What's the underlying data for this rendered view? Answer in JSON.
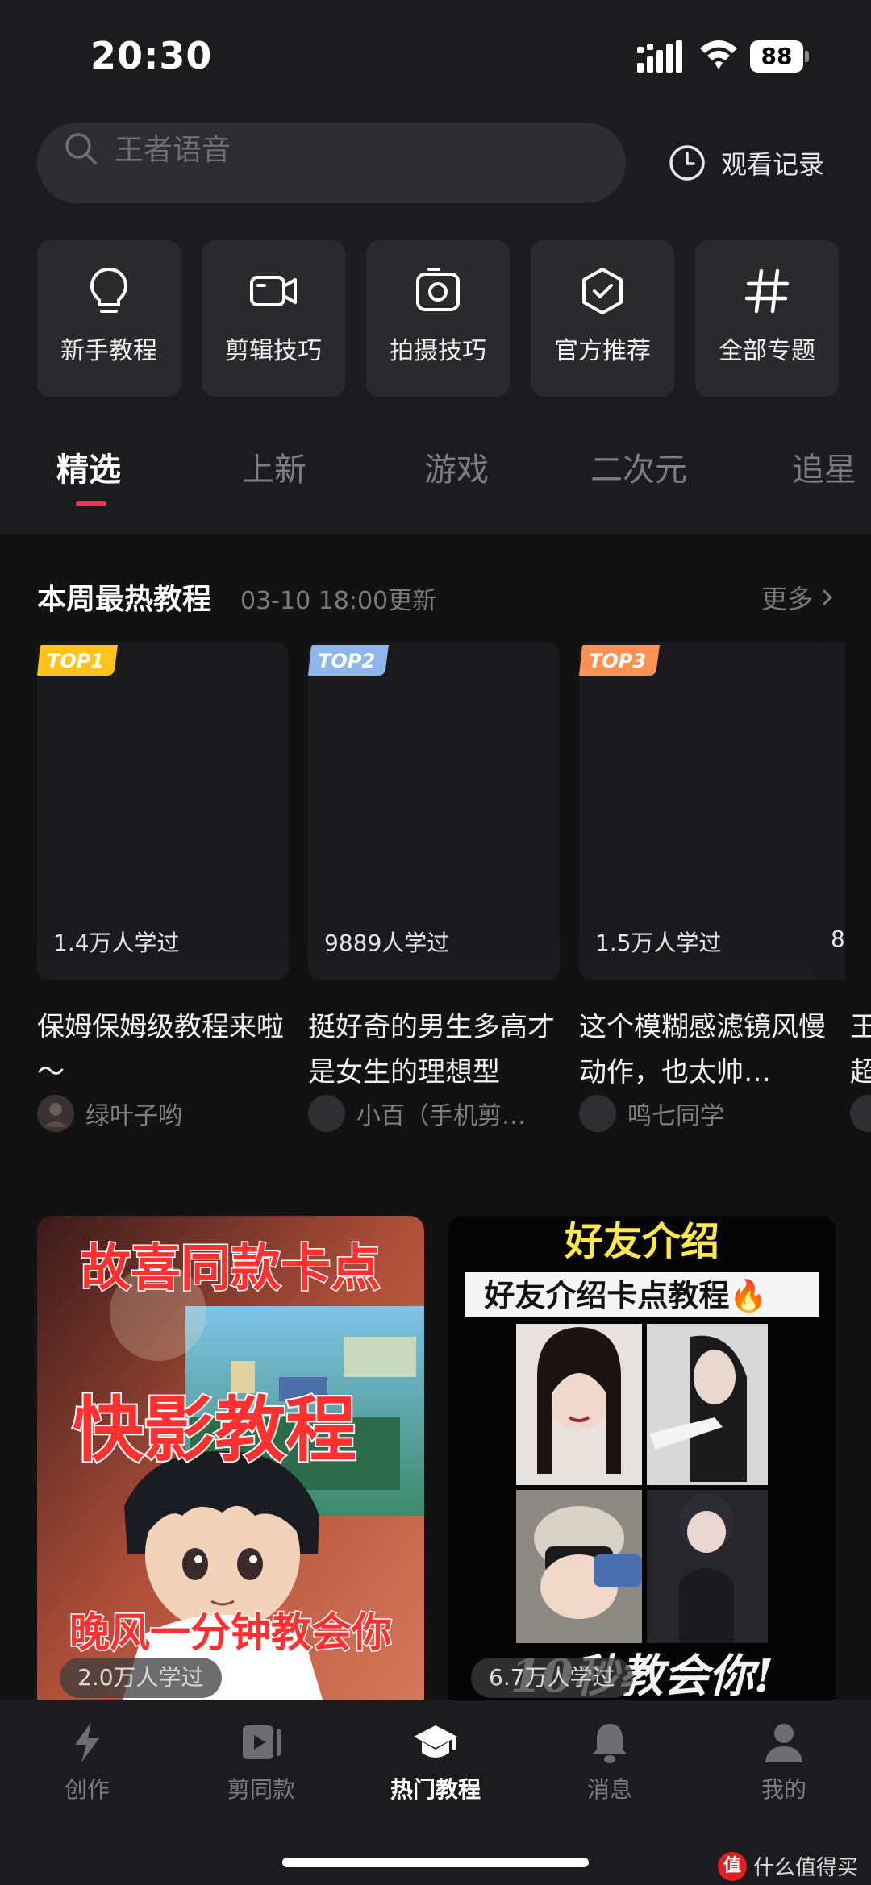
{
  "status_bar": {
    "time": "20:30",
    "battery": "88"
  },
  "search": {
    "placeholder": "王者语音"
  },
  "history": {
    "label": "观看记录"
  },
  "categories": [
    {
      "label": "新手教程",
      "icon": "lightbulb-icon"
    },
    {
      "label": "剪辑技巧",
      "icon": "video-camera-icon"
    },
    {
      "label": "拍摄技巧",
      "icon": "camera-icon"
    },
    {
      "label": "官方推荐",
      "icon": "shield-check-icon"
    },
    {
      "label": "全部专题",
      "icon": "hashtag-icon"
    }
  ],
  "tabs": [
    {
      "label": "精选",
      "active": true
    },
    {
      "label": "上新"
    },
    {
      "label": "游戏"
    },
    {
      "label": "二次元"
    },
    {
      "label": "追星"
    }
  ],
  "hot_section": {
    "title": "本周最热教程",
    "updated": "03-10  18:00更新",
    "more": "更多",
    "cards": [
      {
        "rank": "TOP1",
        "rank_color": "#ffc21a",
        "learned": "1.4万人学过",
        "title": "保姆保姆级教程来啦～",
        "author": "绿叶子哟"
      },
      {
        "rank": "TOP2",
        "rank_color": "#8fb6ea",
        "learned": "9889人学过",
        "title": "挺好奇的男生多高才是女生的理想型",
        "author": "小百（手机剪…"
      },
      {
        "rank": "TOP3",
        "rank_color": "#ff9152",
        "learned": "1.5万人学过",
        "title": "这个模糊感滤镜风慢动作，也太帅…",
        "author": "鸣七同学"
      }
    ],
    "partial_card": {
      "learned": "8",
      "title_line1": "王",
      "title_line2": "超"
    }
  },
  "feed": [
    {
      "headline": "故喜同款卡点",
      "subtitle": "快影教程",
      "caption": "晚风一分钟教会你",
      "learned": "2.0万人学过"
    },
    {
      "headline": "好友介绍",
      "subtitle": "好友介绍卡点教程🔥",
      "caption": "10秒教会你!",
      "learned": "6.7万人学过"
    }
  ],
  "bottom_nav": [
    {
      "label": "创作",
      "icon": "lightning-icon"
    },
    {
      "label": "剪同款",
      "icon": "video-template-icon"
    },
    {
      "label": "热门教程",
      "icon": "graduation-cap-icon",
      "active": true
    },
    {
      "label": "消息",
      "icon": "bell-icon"
    },
    {
      "label": "我的",
      "icon": "person-icon"
    }
  ],
  "watermark": {
    "logo": "值",
    "text": "什么值得买"
  },
  "colors": {
    "accent": "#ff2d55",
    "background": "#1c1c1e",
    "content_bg": "#121212"
  }
}
